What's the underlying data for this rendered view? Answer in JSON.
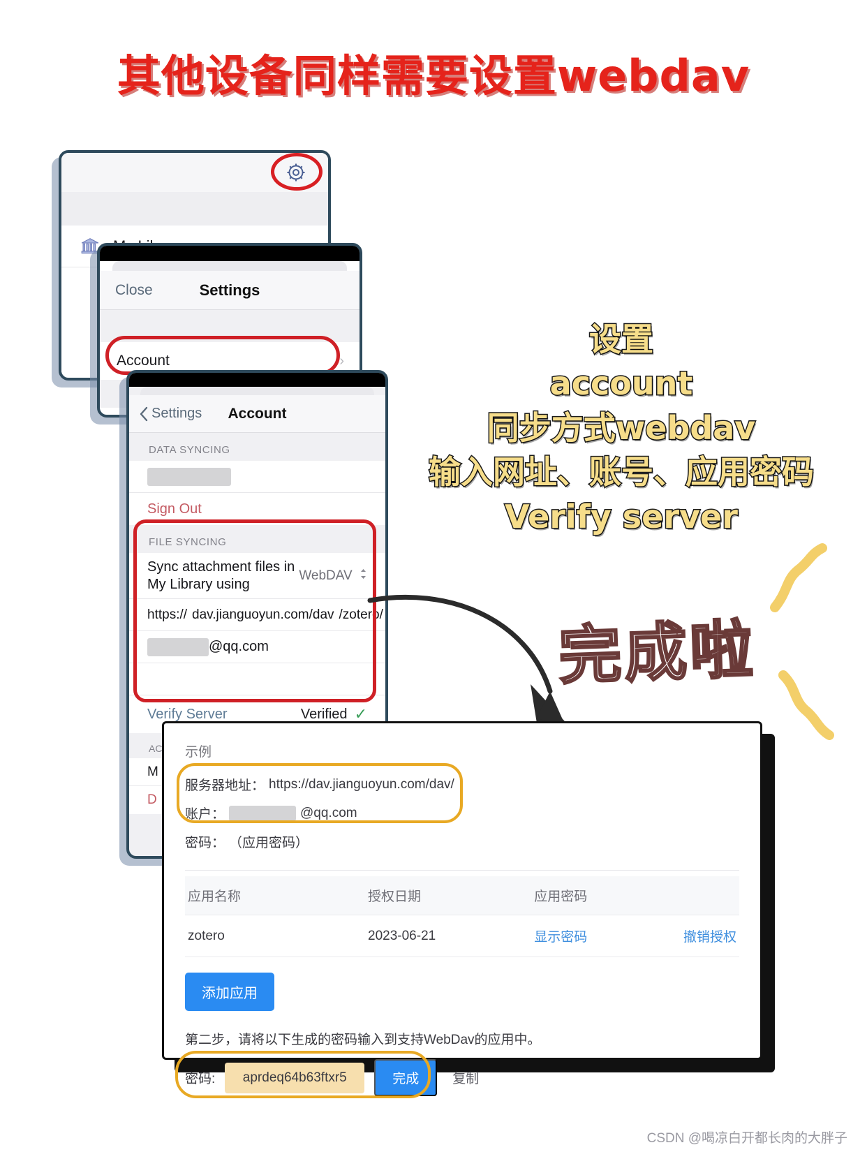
{
  "title": "其他设备同样需要设置webdav",
  "panel_library": {
    "gear_icon": "gear-icon",
    "library_icon": "library-bank-icon",
    "library_label": "My Library"
  },
  "panel_settings": {
    "close_label": "Close",
    "title": "Settings",
    "account_label": "Account",
    "chevron": "›"
  },
  "panel_account": {
    "back_label": "Settings",
    "title": "Account",
    "section_data_syncing": "DATA SYNCING",
    "sign_out_label": "Sign Out",
    "section_file_syncing": "FILE SYNCING",
    "sync_label": "Sync attachment files in My Library using",
    "sync_value": "WebDAV",
    "sync_value_caret": "⌃⌄",
    "url_scheme": "https://",
    "url_host": "dav.jianguoyun.com/dav",
    "url_path": "/zotero/",
    "account_email_suffix": "@qq.com",
    "verify_label": "Verify Server",
    "verify_status": "Verified",
    "verify_tick": "✓",
    "tail_section": "AC"
  },
  "annotation": {
    "lines": [
      "设置",
      "account",
      "同步方式webdav",
      "输入网址、账号、应用密码",
      "Verify server"
    ],
    "done_text": "完成啦",
    "color": "#f6dd8a"
  },
  "bottom_panel": {
    "example_title": "示例",
    "server_key": "服务器地址：",
    "server_value": "https://dav.jianguoyun.com/dav/",
    "account_key": "账户：",
    "account_value_suffix": "@qq.com",
    "password_key": "密码：",
    "password_value": "（应用密码）",
    "table": {
      "headers": [
        "应用名称",
        "授权日期",
        "应用密码",
        ""
      ],
      "rows": [
        {
          "app_name": "zotero",
          "auth_date": "2023-06-21",
          "show_password": "显示密码",
          "revoke": "撤销授权"
        }
      ]
    },
    "add_app_button": "添加应用",
    "step2_text": "第二步，请将以下生成的密码输入到支持WebDav的应用中。",
    "pwd_label": "密码:",
    "pwd_value": "aprdeq64b63ftxr5",
    "done_button": "完成",
    "copy_link": "复制"
  },
  "watermark": "CSDN @喝凉白开都长肉的大胖子"
}
